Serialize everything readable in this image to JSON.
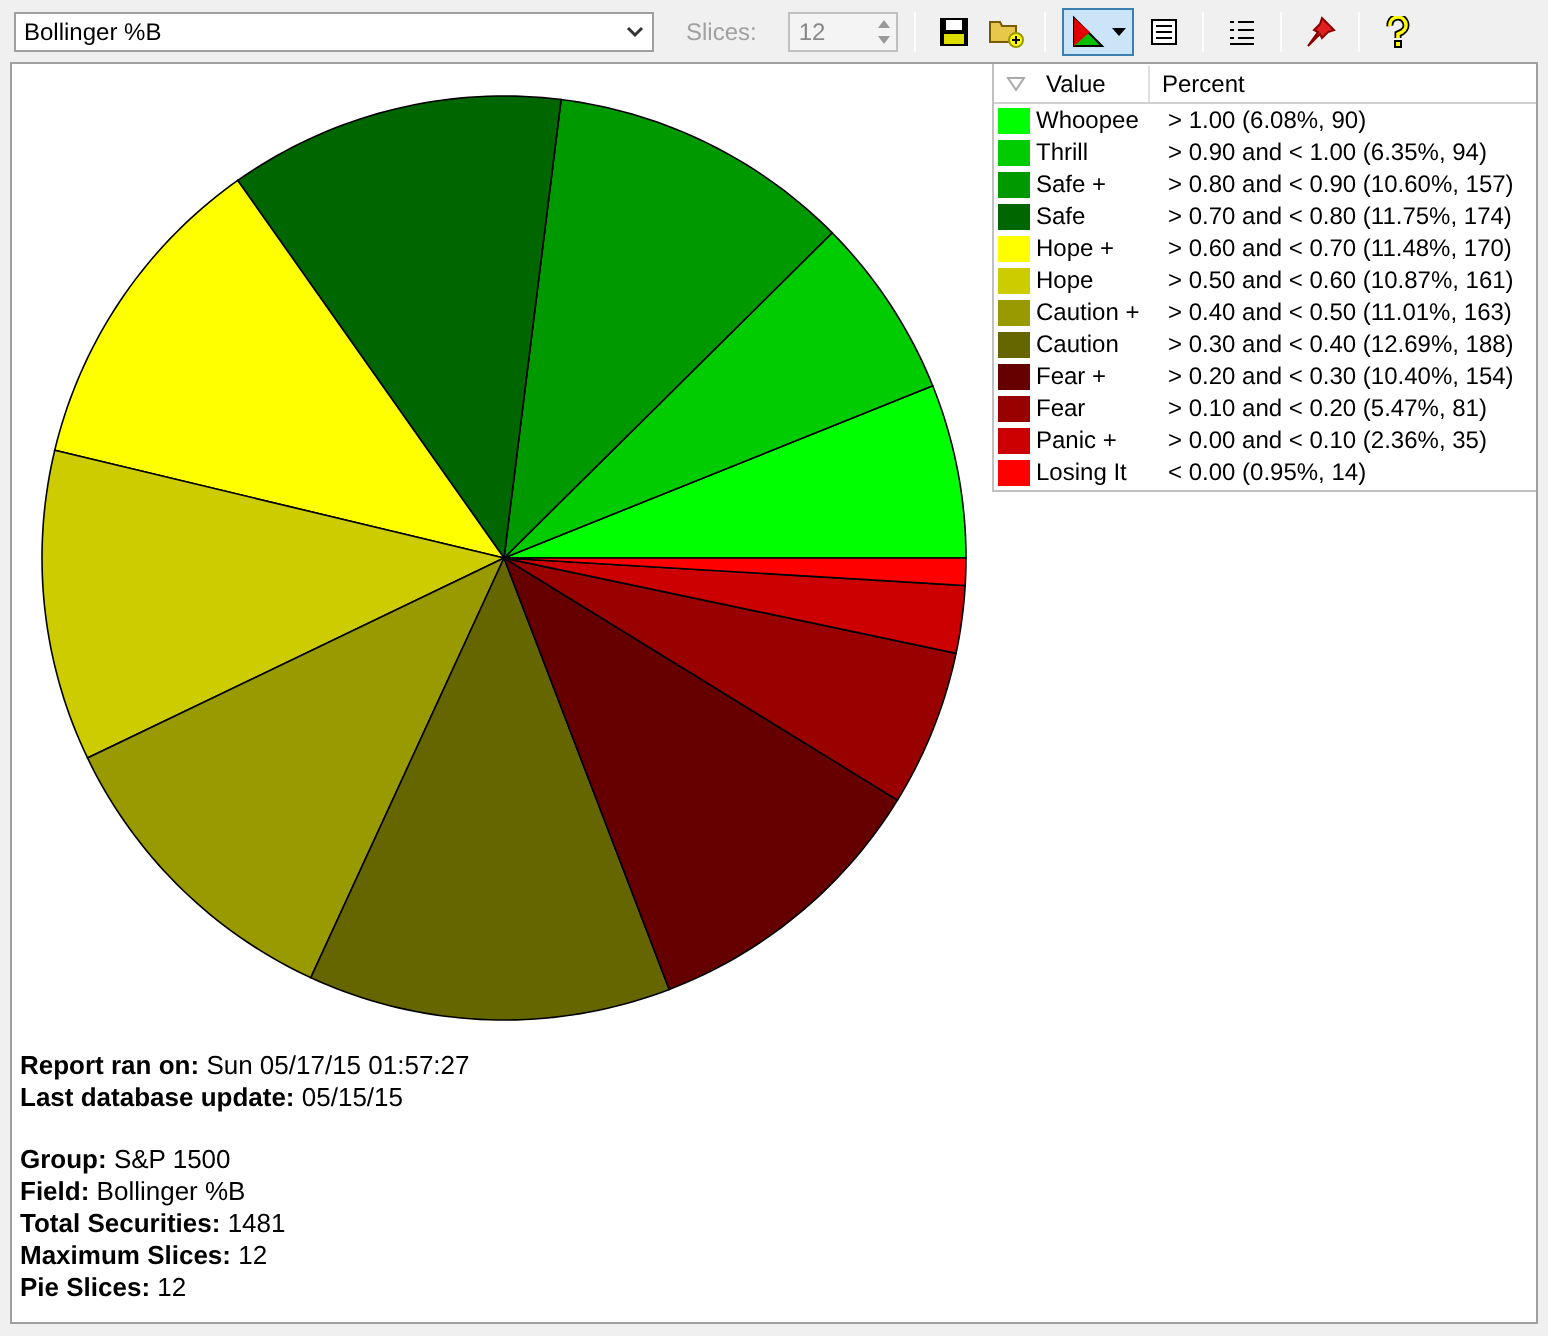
{
  "toolbar": {
    "field_dropdown": {
      "value": "Bollinger %B"
    },
    "slices": {
      "label": "Slices:",
      "value": "12",
      "disabled": true
    },
    "chart_button": {
      "selected": true
    }
  },
  "legend": {
    "columns": [
      "Value",
      "Percent"
    ],
    "items": [
      {
        "range": "> 1.00 (6.08%, 90)",
        "color": "#00ff00"
      },
      {
        "range": "> 0.90 and < 1.00 (6.35%, 94)",
        "color": "#00cc00"
      },
      {
        "range": "> 0.80 and < 0.90 (10.60%, 157)",
        "color": "#009900"
      },
      {
        "range": "> 0.70 and < 0.80 (11.75%, 174)",
        "color": "#006600"
      },
      {
        "range": "> 0.60 and < 0.70 (11.48%, 170)",
        "color": "#ffff00"
      },
      {
        "range": "> 0.50 and < 0.60 (10.87%, 161)",
        "color": "#cccc00"
      },
      {
        "range": "> 0.40 and < 0.50 (11.01%, 163)",
        "color": "#999900"
      },
      {
        "range": "> 0.30 and < 0.40 (12.69%, 188)",
        "color": "#666600"
      },
      {
        "range": "> 0.20 and < 0.30 (10.40%, 154)",
        "color": "#660000"
      },
      {
        "range": "> 0.10 and < 0.20 (5.47%, 81)",
        "color": "#990000"
      },
      {
        "range": "> 0.00 and < 0.10 (2.36%, 35)",
        "color": "#cc0000"
      },
      {
        "range": "< 0.00 (0.95%, 14)",
        "color": "#ff0000"
      }
    ]
  },
  "chart_data": {
    "type": "pie",
    "categories": [
      "Whoopee",
      "Thrill",
      "Safe +",
      "Safe",
      "Hope +",
      "Hope",
      "Caution +",
      "Caution",
      "Fear +",
      "Fear",
      "Panic +",
      "Losing It"
    ],
    "values": [
      6.08,
      6.35,
      10.6,
      11.75,
      11.48,
      10.87,
      11.01,
      12.69,
      10.4,
      5.47,
      2.36,
      0.95
    ]
  },
  "report": [
    [
      {
        "label": "Report ran on:",
        "value": "Sun 05/17/15 01:57:27"
      },
      {
        "label": "Last database update:",
        "value": "05/15/15"
      }
    ],
    [
      {
        "label": "Group:",
        "value": "S&P 1500"
      },
      {
        "label": "Field:",
        "value": "Bollinger %B"
      },
      {
        "label": "Total Securities:",
        "value": "1481"
      },
      {
        "label": "Maximum Slices:",
        "value": "12"
      },
      {
        "label": "Pie Slices:",
        "value": "12"
      }
    ]
  ]
}
